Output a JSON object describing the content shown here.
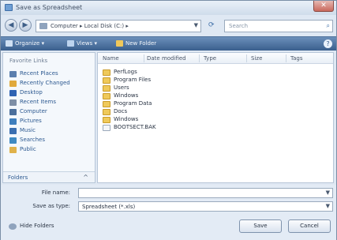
{
  "window": {
    "title": "Save as Spreadsheet",
    "close_glyph": "✕"
  },
  "address_bar": {
    "path": "Computer ▸ Local Disk (C:) ▸",
    "search_placeholder": "Search"
  },
  "command_bar": {
    "organize": "Organize ▾",
    "views": "Views ▾",
    "new_folder": "New Folder"
  },
  "nav_pane": {
    "heading": "Favorite Links",
    "items": [
      {
        "label": "Recent Places",
        "icon": "recent-places-icon",
        "color": "#5b7fae"
      },
      {
        "label": "Recently Changed",
        "icon": "recently-changed-icon",
        "color": "#e0a93b"
      },
      {
        "label": "Desktop",
        "icon": "desktop-icon",
        "color": "#2f63b3"
      },
      {
        "label": "Recent Items",
        "icon": "recent-items-icon",
        "color": "#7e8fa6"
      },
      {
        "label": "Computer",
        "icon": "computer-icon",
        "color": "#4b6f9c"
      },
      {
        "label": "Pictures",
        "icon": "pictures-icon",
        "color": "#3f7fbd"
      },
      {
        "label": "Music",
        "icon": "music-icon",
        "color": "#3b6fb0"
      },
      {
        "label": "Searches",
        "icon": "searches-icon",
        "color": "#3f8ac2"
      },
      {
        "label": "Public",
        "icon": "public-icon",
        "color": "#e0b24a"
      }
    ],
    "folders_label": "Folders",
    "folders_chevron": "^"
  },
  "file_list": {
    "columns": [
      "Name",
      "Date modified",
      "Type",
      "Size",
      "Tags"
    ],
    "rows": [
      {
        "name": "PerfLogs",
        "folder": true
      },
      {
        "name": "Program Files",
        "folder": true
      },
      {
        "name": "Users",
        "folder": true
      },
      {
        "name": "Windows",
        "folder": true
      },
      {
        "name": "Program Data",
        "folder": true
      },
      {
        "name": "Docs",
        "folder": true
      },
      {
        "name": "Windows",
        "folder": true
      },
      {
        "name": "BOOTSECT.BAK",
        "folder": false
      }
    ]
  },
  "save_form": {
    "file_name_label": "File name:",
    "file_name_value": "",
    "save_type_label": "Save as type:",
    "save_type_value": "Spreadsheet (*.xls)"
  },
  "footer": {
    "hide_folders": "Hide Folders",
    "save_button": "Save",
    "cancel_button": "Cancel"
  }
}
